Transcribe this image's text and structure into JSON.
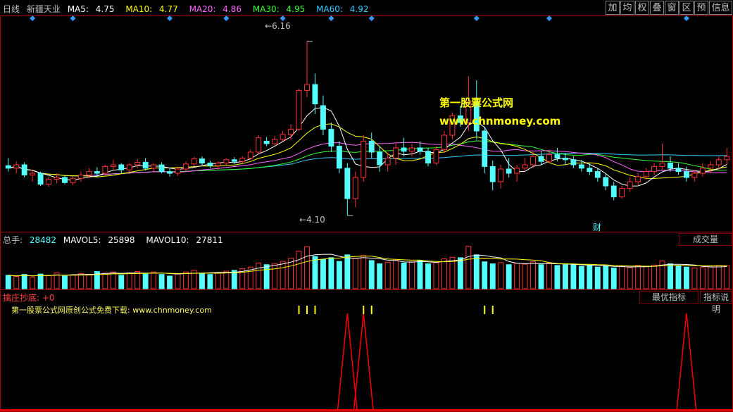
{
  "header": {
    "period": "日线",
    "stock_name": "新疆天业",
    "ma": [
      {
        "label": "MA5:",
        "value": "4.75",
        "color": "#ffffff"
      },
      {
        "label": "MA10:",
        "value": "4.77",
        "color": "#ffff00"
      },
      {
        "label": "MA20:",
        "value": "4.86",
        "color": "#ff66ff"
      },
      {
        "label": "MA30:",
        "value": "4.95",
        "color": "#33ff33"
      },
      {
        "label": "MA60:",
        "value": "4.92",
        "color": "#33ccff"
      }
    ],
    "buttons": [
      "加",
      "均",
      "权",
      "叠",
      "窗",
      "区",
      "预",
      "信息"
    ]
  },
  "price_panel": {
    "high_label": "6.16",
    "low_label": "4.10",
    "finance_marker": "财",
    "watermark_line1": "第一股票公式网",
    "watermark_line2": "www.chnmoney.com"
  },
  "volume_panel": {
    "title": "总手:",
    "value": "28482",
    "mavol5_label": "MAVOL5:",
    "mavol5_value": "25898",
    "mavol10_label": "MAVOL10:",
    "mavol10_value": "27811",
    "button": "成交量"
  },
  "indicator_panel": {
    "title": "擒庄抄底:",
    "title_value": "+0",
    "ad_text": "第一股票公式网原创公式免费下载: www.chnmoney.com",
    "button_best": "最优指标",
    "button_help": "指标说明"
  },
  "colors": {
    "up": "#ff3232",
    "down": "#54ffff",
    "panel_border": "#b00000",
    "signal_bar": "#ffff00",
    "indicator_line": "#ff0000",
    "watermark": "#ffff00"
  },
  "chart_data": {
    "type": "candlestick",
    "candles": [
      [
        4.69,
        4.78,
        4.62,
        4.66
      ],
      [
        4.66,
        4.74,
        4.6,
        4.7
      ],
      [
        4.7,
        4.73,
        4.55,
        4.58
      ],
      [
        4.58,
        4.64,
        4.5,
        4.6
      ],
      [
        4.6,
        4.62,
        4.45,
        4.47
      ],
      [
        4.47,
        4.56,
        4.44,
        4.53
      ],
      [
        4.53,
        4.6,
        4.48,
        4.55
      ],
      [
        4.55,
        4.57,
        4.47,
        4.49
      ],
      [
        4.49,
        4.56,
        4.46,
        4.54
      ],
      [
        4.54,
        4.62,
        4.5,
        4.58
      ],
      [
        4.58,
        4.66,
        4.54,
        4.62
      ],
      [
        4.62,
        4.67,
        4.56,
        4.6
      ],
      [
        4.6,
        4.7,
        4.58,
        4.68
      ],
      [
        4.68,
        4.76,
        4.64,
        4.7
      ],
      [
        4.7,
        4.72,
        4.6,
        4.64
      ],
      [
        4.64,
        4.72,
        4.61,
        4.7
      ],
      [
        4.7,
        4.77,
        4.66,
        4.73
      ],
      [
        4.73,
        4.78,
        4.63,
        4.66
      ],
      [
        4.66,
        4.72,
        4.62,
        4.7
      ],
      [
        4.7,
        4.73,
        4.6,
        4.62
      ],
      [
        4.62,
        4.66,
        4.56,
        4.6
      ],
      [
        4.6,
        4.68,
        4.57,
        4.65
      ],
      [
        4.65,
        4.74,
        4.62,
        4.71
      ],
      [
        4.71,
        4.79,
        4.68,
        4.77
      ],
      [
        4.77,
        4.8,
        4.7,
        4.72
      ],
      [
        4.72,
        4.75,
        4.66,
        4.69
      ],
      [
        4.69,
        4.74,
        4.64,
        4.72
      ],
      [
        4.72,
        4.78,
        4.7,
        4.76
      ],
      [
        4.76,
        4.79,
        4.71,
        4.74
      ],
      [
        4.74,
        4.8,
        4.72,
        4.78
      ],
      [
        4.78,
        4.88,
        4.76,
        4.85
      ],
      [
        4.85,
        5.05,
        4.83,
        5.02
      ],
      [
        4.98,
        5.03,
        4.92,
        4.95
      ],
      [
        4.95,
        5.04,
        4.93,
        5.0
      ],
      [
        5.0,
        5.1,
        4.98,
        5.06
      ],
      [
        5.06,
        5.18,
        5.0,
        5.12
      ],
      [
        5.12,
        5.6,
        5.1,
        5.58
      ],
      [
        5.58,
        6.16,
        5.5,
        5.65
      ],
      [
        5.65,
        5.78,
        5.3,
        5.42
      ],
      [
        5.4,
        5.52,
        5.05,
        5.12
      ],
      [
        5.12,
        5.2,
        4.85,
        4.92
      ],
      [
        4.92,
        4.98,
        4.6,
        4.66
      ],
      [
        4.66,
        4.72,
        4.1,
        4.3
      ],
      [
        4.3,
        4.62,
        4.2,
        4.55
      ],
      [
        4.55,
        5.05,
        4.5,
        4.98
      ],
      [
        4.98,
        5.08,
        4.78,
        4.85
      ],
      [
        4.85,
        4.92,
        4.62,
        4.7
      ],
      [
        4.7,
        4.84,
        4.62,
        4.78
      ],
      [
        4.78,
        4.95,
        4.7,
        4.9
      ],
      [
        4.9,
        5.02,
        4.8,
        4.86
      ],
      [
        4.86,
        4.95,
        4.8,
        4.9
      ],
      [
        4.9,
        4.98,
        4.82,
        4.86
      ],
      [
        4.86,
        4.9,
        4.68,
        4.72
      ],
      [
        4.72,
        4.92,
        4.7,
        4.88
      ],
      [
        4.88,
        5.1,
        4.84,
        5.05
      ],
      [
        5.05,
        5.32,
        5.0,
        5.28
      ],
      [
        5.28,
        5.4,
        5.15,
        5.2
      ],
      [
        5.2,
        5.75,
        5.1,
        5.45
      ],
      [
        5.45,
        5.7,
        5.0,
        5.1
      ],
      [
        5.1,
        5.15,
        4.6,
        4.68
      ],
      [
        4.68,
        4.75,
        4.4,
        4.5
      ],
      [
        4.5,
        4.7,
        4.42,
        4.65
      ],
      [
        4.65,
        4.78,
        4.55,
        4.6
      ],
      [
        4.6,
        4.7,
        4.5,
        4.66
      ],
      [
        4.66,
        4.78,
        4.62,
        4.7
      ],
      [
        4.7,
        4.85,
        4.66,
        4.8
      ],
      [
        4.8,
        4.86,
        4.7,
        4.74
      ],
      [
        4.74,
        4.88,
        4.72,
        4.82
      ],
      [
        4.82,
        4.9,
        4.74,
        4.78
      ],
      [
        4.78,
        4.84,
        4.7,
        4.76
      ],
      [
        4.76,
        4.8,
        4.66,
        4.7
      ],
      [
        4.7,
        4.76,
        4.62,
        4.66
      ],
      [
        4.66,
        4.72,
        4.58,
        4.62
      ],
      [
        4.62,
        4.66,
        4.5,
        4.55
      ],
      [
        4.55,
        4.6,
        4.4,
        4.45
      ],
      [
        4.45,
        4.5,
        4.28,
        4.32
      ],
      [
        4.32,
        4.45,
        4.3,
        4.42
      ],
      [
        4.42,
        4.55,
        4.38,
        4.5
      ],
      [
        4.5,
        4.6,
        4.46,
        4.56
      ],
      [
        4.56,
        4.66,
        4.52,
        4.62
      ],
      [
        4.62,
        4.72,
        4.58,
        4.68
      ],
      [
        4.68,
        4.95,
        4.64,
        4.72
      ],
      [
        4.72,
        4.8,
        4.62,
        4.66
      ],
      [
        4.66,
        4.72,
        4.58,
        4.62
      ],
      [
        4.62,
        4.68,
        4.5,
        4.55
      ],
      [
        4.55,
        4.64,
        4.5,
        4.6
      ],
      [
        4.6,
        4.72,
        4.56,
        4.66
      ],
      [
        4.66,
        4.74,
        4.6,
        4.7
      ],
      [
        4.7,
        4.8,
        4.64,
        4.76
      ],
      [
        4.76,
        4.9,
        4.7,
        4.8
      ]
    ],
    "volume": [
      16500,
      15000,
      17500,
      14000,
      18000,
      16000,
      19500,
      15500,
      17000,
      18500,
      17500,
      21000,
      19000,
      20500,
      16500,
      19500,
      21000,
      18000,
      20500,
      17500,
      15500,
      18500,
      20500,
      22500,
      19000,
      17500,
      20000,
      21500,
      22500,
      24500,
      26500,
      31500,
      29500,
      31000,
      33500,
      37500,
      46000,
      51500,
      39500,
      36000,
      38000,
      33500,
      41500,
      37000,
      40500,
      34500,
      30500,
      32500,
      35000,
      31500,
      33000,
      34500,
      30500,
      32000,
      36500,
      38500,
      38000,
      52000,
      41500,
      33000,
      30500,
      32000,
      29500,
      31000,
      30000,
      33000,
      29500,
      31500,
      28500,
      29500,
      30000,
      27500,
      29000,
      26500,
      28000,
      25500,
      27000,
      26000,
      28500,
      27500,
      29000,
      34000,
      30500,
      28500,
      26500,
      25500,
      26000,
      27000,
      28500,
      28482
    ],
    "indicator_signal_days": [
      42,
      44,
      84
    ],
    "yellow_marker_days": [
      36,
      37,
      38,
      44,
      45,
      59,
      60
    ],
    "price_ylim": [
      4.0,
      6.4
    ],
    "volume_ylim": [
      0,
      56000
    ]
  }
}
